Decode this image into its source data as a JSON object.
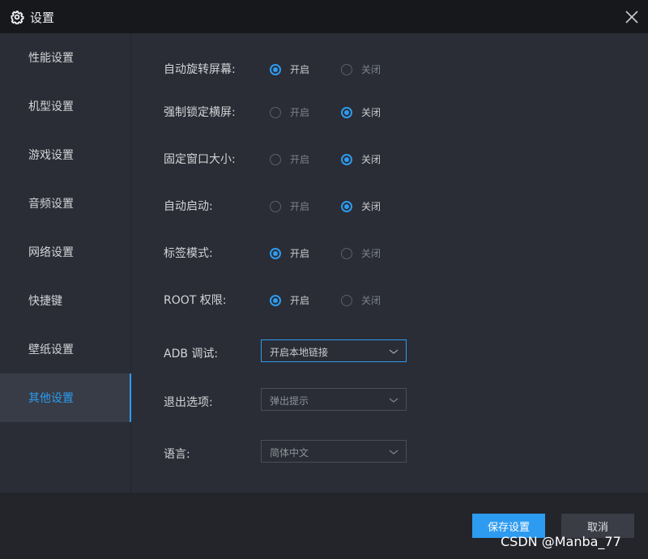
{
  "window": {
    "title": "设置",
    "close_icon": "close-icon"
  },
  "colors": {
    "accent": "#2d9bf0",
    "title_bg": "#17181c",
    "panel_bg": "#2a2d35"
  },
  "sidebar": {
    "items": [
      {
        "label": "性能设置",
        "active": false
      },
      {
        "label": "机型设置",
        "active": false
      },
      {
        "label": "游戏设置",
        "active": false
      },
      {
        "label": "音频设置",
        "active": false
      },
      {
        "label": "网络设置",
        "active": false
      },
      {
        "label": "快捷键",
        "active": false
      },
      {
        "label": "壁纸设置",
        "active": false
      },
      {
        "label": "其他设置",
        "active": true
      }
    ]
  },
  "settings": {
    "radios": [
      {
        "label": "自动旋转屏幕:",
        "on": "开启",
        "off": "关闭",
        "selected": "on"
      },
      {
        "label": "强制锁定横屏:",
        "on": "开启",
        "off": "关闭",
        "selected": "off"
      },
      {
        "label": "固定窗口大小:",
        "on": "开启",
        "off": "关闭",
        "selected": "off"
      },
      {
        "label": "自动启动:",
        "on": "开启",
        "off": "关闭",
        "selected": "off"
      },
      {
        "label": "标签模式:",
        "on": "开启",
        "off": "关闭",
        "selected": "on"
      },
      {
        "label": "ROOT 权限:",
        "on": "开启",
        "off": "关闭",
        "selected": "on"
      }
    ],
    "selects": [
      {
        "label": "ADB 调试:",
        "value": "开启本地链接",
        "focused": true
      },
      {
        "label": "退出选项:",
        "value": "弹出提示",
        "focused": false
      },
      {
        "label": "语言:",
        "value": "简体中文",
        "focused": false
      }
    ]
  },
  "footer": {
    "save_label": "保存设置",
    "cancel_label": "取消",
    "watermark": "CSDN @Manba_77"
  }
}
